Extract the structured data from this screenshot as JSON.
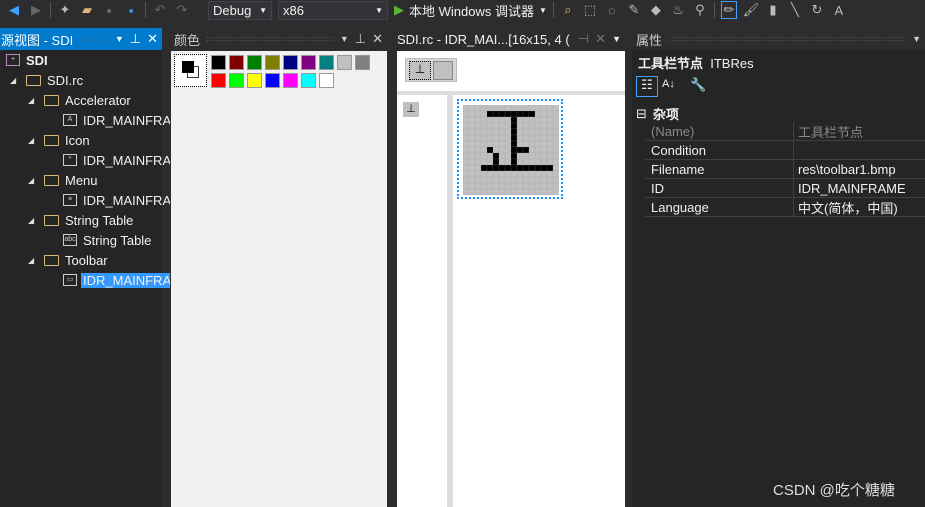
{
  "toolbar": {
    "config": "Debug",
    "platform": "x86",
    "run_label": "本地 Windows 调试器",
    "icons": [
      "back-icon",
      "forward-icon",
      "new-item-icon",
      "open-folder-icon",
      "save-icon",
      "save-all-icon",
      "undo-icon",
      "redo-icon",
      "find-icon",
      "rect-select-icon",
      "lasso-select-icon",
      "eyedropper-icon",
      "eraser-icon",
      "fill-icon",
      "magnify-icon",
      "pencil-icon",
      "brush-icon",
      "airbrush-icon",
      "line-icon",
      "curve-icon",
      "text-icon"
    ]
  },
  "resource_view": {
    "title": "资源视图 - SDI",
    "root": "SDI",
    "rc": "SDI.rc",
    "items": [
      {
        "folder": "Accelerator",
        "child": "IDR_MAINFRAME",
        "icon": "A"
      },
      {
        "folder": "Icon",
        "child": "IDR_MAINFRAME",
        "icon": "*"
      },
      {
        "folder": "Menu",
        "child": "IDR_MAINFRAME",
        "icon": "≡"
      },
      {
        "folder": "String Table",
        "child": "String Table",
        "icon": "abc"
      },
      {
        "folder": "Toolbar",
        "child": "IDR_MAINFRAME",
        "icon": "▭"
      }
    ],
    "selected": "IDR_MAINFRAME"
  },
  "colors_panel": {
    "title": "颜色",
    "palette": [
      "#000000",
      "#800000",
      "#008000",
      "#808000",
      "#000080",
      "#800080",
      "#008080",
      "#c0c0c0",
      "#808080",
      "#ff0000",
      "#00ff00",
      "#ffff00",
      "#0000ff",
      "#ff00ff",
      "#00ffff",
      "#ffffff"
    ]
  },
  "editor": {
    "tab": "SDI.rc - IDR_MAI...[16x15, 4 (",
    "bitmap": [
      "................",
      "....########....",
      "........#.......",
      "........#.......",
      "........#.......",
      "........#.......",
      "........#.......",
      "....#...###.....",
      ".....#..#.......",
      ".....#..#.......",
      "...############.",
      "................",
      "................",
      "................",
      "................"
    ]
  },
  "properties": {
    "title": "属性",
    "object": "工具栏节点",
    "type": "ITBRes",
    "category": "杂项",
    "rows": [
      {
        "k": "(Name)",
        "v": "工具栏节点"
      },
      {
        "k": "Condition",
        "v": ""
      },
      {
        "k": "Filename",
        "v": "res\\toolbar1.bmp"
      },
      {
        "k": "ID",
        "v": "IDR_MAINFRAME"
      },
      {
        "k": "Language",
        "v": "中文(简体，中国)"
      }
    ]
  },
  "watermark": "CSDN @吃个糖糖"
}
